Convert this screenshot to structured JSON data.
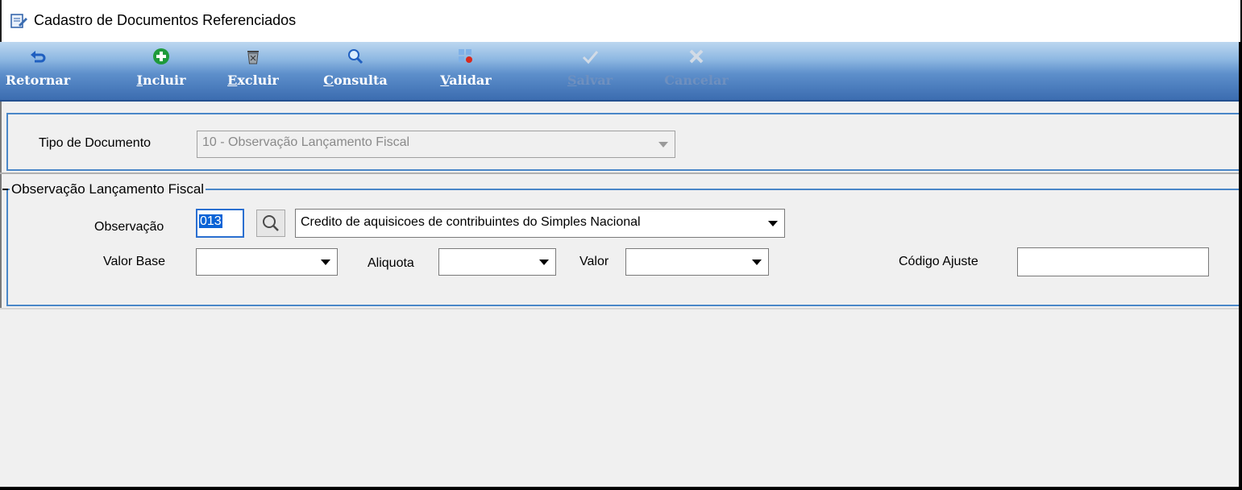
{
  "window": {
    "title": "Cadastro de Documentos Referenciados"
  },
  "toolbar": {
    "buttons": [
      {
        "key": "retornar",
        "accel": "",
        "rest": "Retornar",
        "icon": "return-icon",
        "enabled": true
      },
      {
        "key": "incluir",
        "accel": "I",
        "rest": "ncluir",
        "icon": "add-icon",
        "enabled": true
      },
      {
        "key": "excluir",
        "accel": "E",
        "rest": "xcluir",
        "icon": "trash-icon",
        "enabled": true
      },
      {
        "key": "consulta",
        "accel": "C",
        "rest": "onsulta",
        "icon": "search-icon",
        "enabled": true
      },
      {
        "key": "validar",
        "accel": "V",
        "rest": "alidar",
        "icon": "validate-icon",
        "enabled": true
      },
      {
        "key": "salvar",
        "accel": "S",
        "rest": "alvar",
        "icon": "check-icon",
        "enabled": false
      },
      {
        "key": "cancelar",
        "accel": "",
        "rest": "Cancelar",
        "icon": "cancel-icon",
        "enabled": false
      }
    ]
  },
  "tipo_documento": {
    "label": "Tipo de Documento",
    "value": "10 - Observação Lançamento Fiscal"
  },
  "group": {
    "legend": "Observação Lançamento Fiscal",
    "observacao": {
      "label": "Observação",
      "code": "013",
      "description": "Credito de aquisicoes de contribuintes do Simples Nacional"
    },
    "valor_base": {
      "label": "Valor Base",
      "value": ""
    },
    "aliquota": {
      "label": "Aliquota",
      "value": ""
    },
    "valor": {
      "label": "Valor",
      "value": ""
    },
    "codigo_ajuste": {
      "label": "Código Ajuste",
      "value": ""
    }
  },
  "colors": {
    "toolbar_top": "#bcd7f0",
    "toolbar_bottom": "#3b6cb0",
    "group_border": "#4a87c8",
    "selection": "#0a63d6"
  }
}
